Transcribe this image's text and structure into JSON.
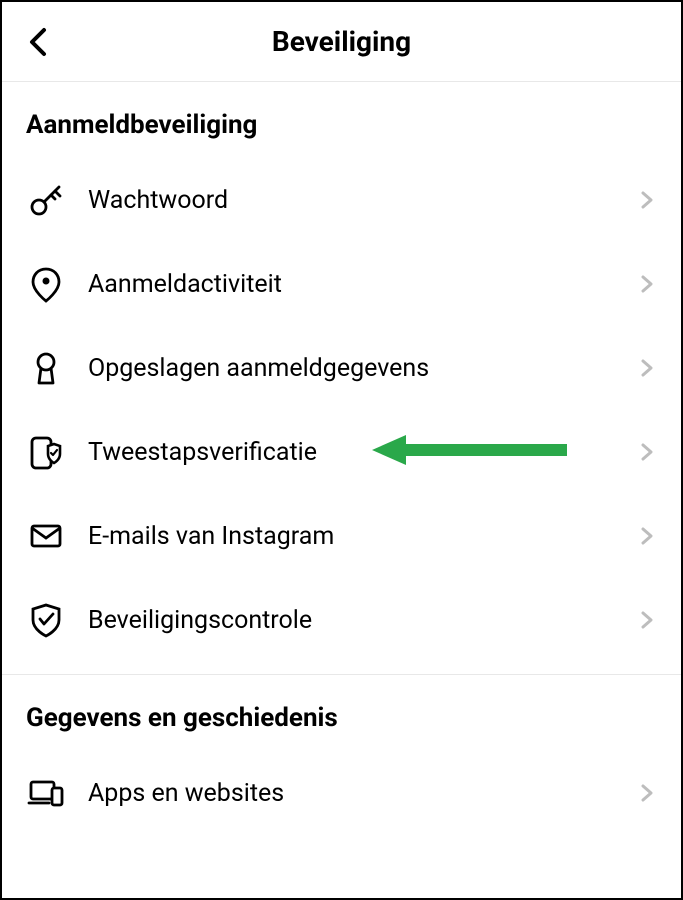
{
  "header": {
    "title": "Beveiliging"
  },
  "sections": [
    {
      "title": "Aanmeldbeveiliging",
      "items": [
        {
          "icon": "key-icon",
          "label": "Wachtwoord"
        },
        {
          "icon": "location-pin-icon",
          "label": "Aanmeldactiviteit"
        },
        {
          "icon": "keyhole-icon",
          "label": "Opgeslagen aanmeldgegevens"
        },
        {
          "icon": "two-factor-icon",
          "label": "Tweestapsverificatie",
          "highlighted": true
        },
        {
          "icon": "mail-icon",
          "label": "E-mails van Instagram"
        },
        {
          "icon": "shield-check-icon",
          "label": "Beveiligingscontrole"
        }
      ]
    },
    {
      "title": "Gegevens en geschiedenis",
      "items": [
        {
          "icon": "devices-icon",
          "label": "Apps en websites"
        }
      ]
    }
  ],
  "annotation": {
    "arrow_color": "#2aa84a"
  }
}
